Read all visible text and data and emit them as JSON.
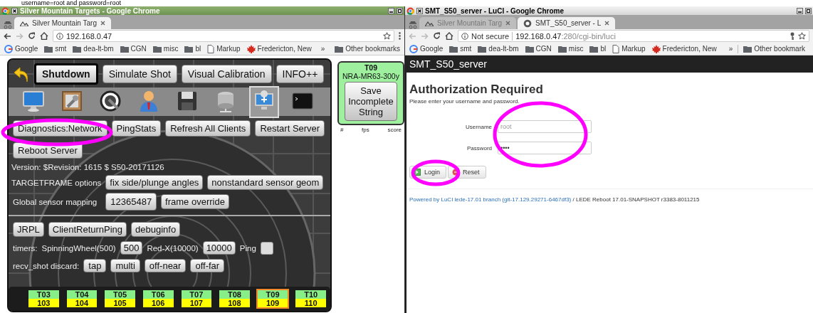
{
  "caption": "username=root and password=root",
  "windows": [
    {
      "title": "Silver Mountain Targets - Google Chrome",
      "focused": true,
      "back_enabled": true,
      "tabs": [
        {
          "label": "Silver Mountain Targ",
          "kind": "mountain",
          "selected": true
        }
      ],
      "address": {
        "host": "192.168.0.47"
      },
      "bookmarks": [
        {
          "label": "Google",
          "kind": "google"
        },
        {
          "label": "smt",
          "kind": "folder"
        },
        {
          "label": "dea-lt-bm",
          "kind": "folder"
        },
        {
          "label": "CGN",
          "kind": "folder"
        },
        {
          "label": "misc",
          "kind": "folder"
        },
        {
          "label": "bl",
          "kind": "folder"
        },
        {
          "label": "Markup",
          "kind": "page"
        },
        {
          "label": "Fredericton, New",
          "kind": "leaf"
        }
      ],
      "overflow": "»",
      "other": "Other bookmarks"
    },
    {
      "title": "SMT_S50_server - LuCI - Google Chrome",
      "focused": false,
      "back_enabled": false,
      "tabs": [
        {
          "label": "Silver Mountain Targ",
          "kind": "mountain",
          "selected": false
        },
        {
          "label": "SMT_S50_server - L",
          "kind": "router",
          "selected": true
        }
      ],
      "address": {
        "security": "Not secure",
        "host": "192.168.0.47",
        "path": ":280/cgi-bin/luci"
      },
      "bookmarks": [
        {
          "label": "Google",
          "kind": "google"
        },
        {
          "label": "smt",
          "kind": "folder"
        },
        {
          "label": "dea-lt-bm",
          "kind": "folder"
        },
        {
          "label": "CGN",
          "kind": "folder"
        },
        {
          "label": "misc",
          "kind": "folder"
        },
        {
          "label": "bl",
          "kind": "folder"
        },
        {
          "label": "Markup",
          "kind": "page"
        },
        {
          "label": "Fredericton, New",
          "kind": "leaf"
        }
      ],
      "overflow": "»",
      "other": "Other bookmark"
    }
  ],
  "smt_page": {
    "top_buttons": [
      {
        "label": "Shutdown",
        "selected": true
      },
      {
        "label": "Simulate Shot",
        "selected": false
      },
      {
        "label": "Visual Calibration",
        "selected": false
      },
      {
        "label": "INFO++",
        "selected": false
      }
    ],
    "tool_icons": [
      {
        "kind": "monitor",
        "selected": false
      },
      {
        "kind": "frame-wrench",
        "selected": false
      },
      {
        "kind": "wrench-circle",
        "selected": false
      },
      {
        "kind": "person",
        "selected": false
      },
      {
        "kind": "floppy",
        "selected": false
      },
      {
        "kind": "database",
        "selected": false
      },
      {
        "kind": "usb-computer",
        "selected": true
      },
      {
        "kind": "terminal",
        "selected": false
      }
    ],
    "diag_buttons": [
      "Diagnostics:Network",
      "PingStats",
      "Refresh All Clients",
      "Restart Server",
      "Reboot Server"
    ],
    "version": "Version: $Revision: 1615 $ S50-20171126",
    "targetframe": {
      "label": "TARGETFRAME options",
      "buttons": [
        "fix side/plunge angles",
        "nonstandard sensor geom"
      ]
    },
    "mapping": {
      "label": "Global sensor mapping",
      "buttons": [
        "12365487",
        "frame override"
      ]
    },
    "debug_buttons": [
      "JRPL",
      "ClientReturnPing",
      "debuginfo"
    ],
    "timers": {
      "label": "timers:",
      "items": [
        {
          "label": "SpinningWheel(500)",
          "value": "500"
        },
        {
          "label": "Red-X(10000)",
          "value": "10000"
        }
      ],
      "ping_label": "Ping",
      "ping_checked": false
    },
    "discard": {
      "label": "recv_shot discard:",
      "buttons": [
        "tap",
        "multi",
        "off-near",
        "off-far"
      ]
    },
    "targets": [
      {
        "name": "T03",
        "number": "103",
        "selected": false
      },
      {
        "name": "T04",
        "number": "104",
        "selected": false
      },
      {
        "name": "T05",
        "number": "105",
        "selected": false
      },
      {
        "name": "T06",
        "number": "106",
        "selected": false
      },
      {
        "name": "T07",
        "number": "107",
        "selected": false
      },
      {
        "name": "T08",
        "number": "108",
        "selected": false
      },
      {
        "name": "T09",
        "number": "109",
        "selected": true
      },
      {
        "name": "T10",
        "number": "110",
        "selected": false
      }
    ],
    "side_card": {
      "target": "T09",
      "profile": "NRA-MR63-300y",
      "button": "Save Incomplete String",
      "columns": [
        "#",
        "fps",
        "score"
      ]
    }
  },
  "luci_page": {
    "header": "SMT_S50_server",
    "heading": "Authorization Required",
    "intro": "Please enter your username and password.",
    "fields": [
      {
        "label": "Username",
        "placeholder": "root"
      },
      {
        "label": "Password",
        "value": "••••"
      }
    ],
    "buttons": [
      {
        "label": "Login",
        "kind": "login"
      },
      {
        "label": "Reset",
        "kind": "reset"
      }
    ],
    "footer_link": "Powered by LuCI lede-17.01 branch (git-17.129.29271-6467df3)",
    "footer_text": " / LEDE Reboot 17.01-SNAPSHOT r3383-8011215"
  }
}
